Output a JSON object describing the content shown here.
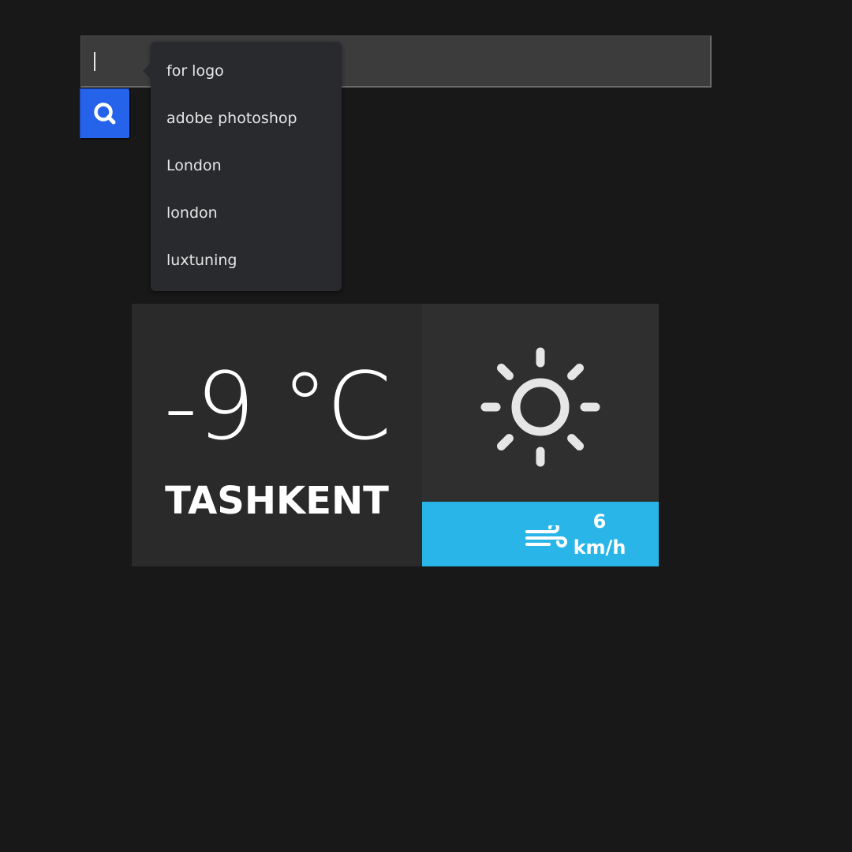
{
  "search": {
    "value": "",
    "placeholder": "",
    "button_icon": "search-icon",
    "button_color": "#2563eb"
  },
  "suggestions": [
    {
      "label": "for logo"
    },
    {
      "label": "adobe photoshop"
    },
    {
      "label": "London"
    },
    {
      "label": "london"
    },
    {
      "label": "luxtuning"
    }
  ],
  "weather": {
    "temperature": "-9 °C",
    "city": "TASHKENT",
    "condition_icon": "sun-icon",
    "wind": {
      "icon": "wind-icon",
      "speed": "6",
      "unit": "km/h",
      "color": "#29b5e8"
    }
  }
}
